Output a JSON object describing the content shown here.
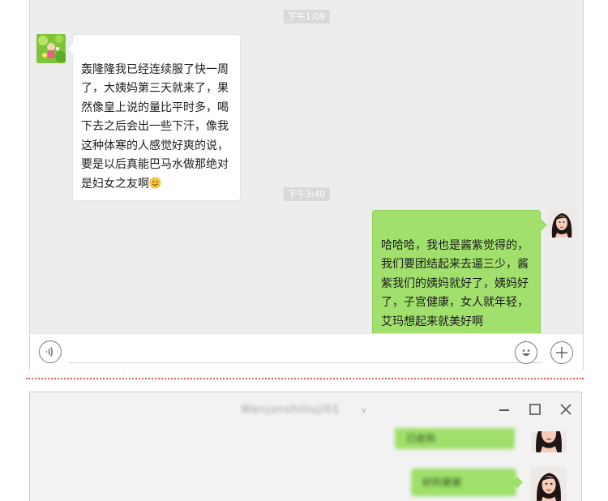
{
  "chat": {
    "timestamp_1": "下午1:09",
    "timestamp_2": "下午3:40",
    "incoming_message": "轰隆隆我已经连续服了快一周了，大姨妈第三天就来了，果然像皇上说的量比平时多，喝下去之后会出一些下汗，像我这种体寒的人感觉好爽的说，要是以后真能巴马水做那绝对是妇女之友啊",
    "outgoing_message": "哈哈哈，我也是酱紫觉得的，我们要团结起来去逼三少，酱紫我们的姨妈就好了，姨妈好了，子宫健康，女人就年轻，艾玛想起来就美好啊",
    "incoming_avatar_icon": "green-cartoon-avatar",
    "outgoing_avatar_icon": "woman-portrait-avatar",
    "incoming_emoji_icon": "smiling-face-emoji",
    "input_bar": {
      "voice_icon": "voice-icon",
      "emoji_icon": "smile-face-icon",
      "plus_icon": "plus-icon"
    }
  },
  "pc_window": {
    "title_blurred": "Wanjunshiliuji01",
    "message_1_blurred": "已收到",
    "message_2_blurred": "好的谢谢",
    "window_controls": [
      "minimize-icon",
      "maximize-icon",
      "close-icon"
    ]
  },
  "colors": {
    "chat_background": "#ededed",
    "outgoing_bubble": "#a2e06e",
    "incoming_bubble": "#ffffff",
    "separator": "#e15a5a",
    "timestamp_bg": "#d9d9d9"
  }
}
